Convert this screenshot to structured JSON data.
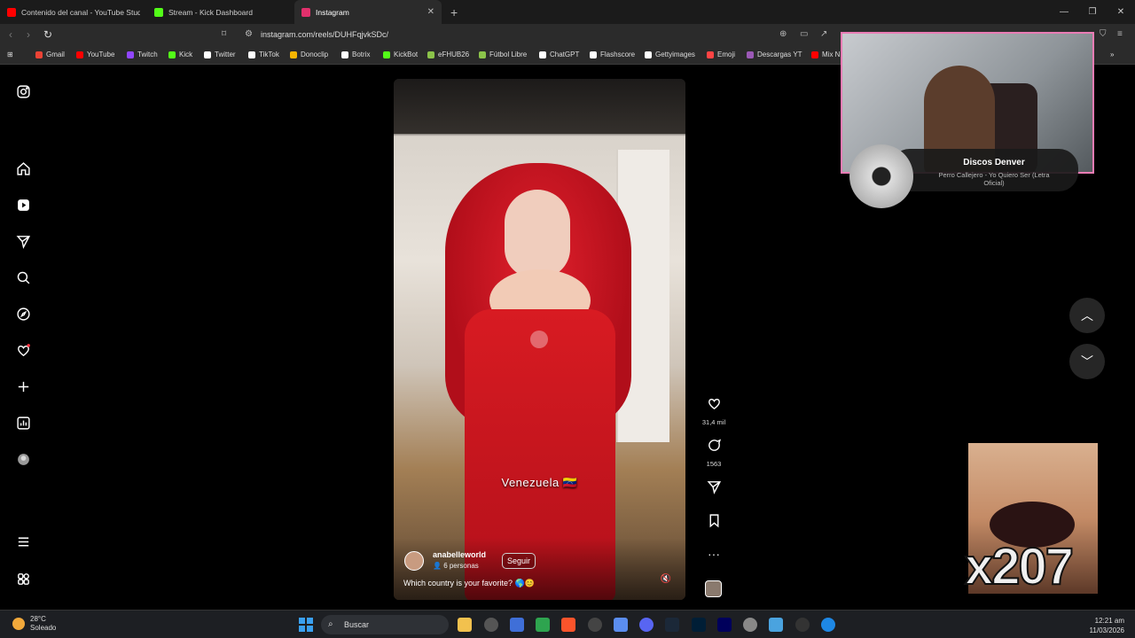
{
  "browser": {
    "tabs": [
      {
        "label": "Contenido del canal - YouTube Studio",
        "color": "#ff0000"
      },
      {
        "label": "Stream - Kick Dashboard",
        "color": "#53fc18"
      },
      {
        "label": "Instagram",
        "color": "#e1306c"
      }
    ],
    "url": "instagram.com/reels/DUHFqjvkSDc/",
    "bookmarks": [
      {
        "label": "Gmail",
        "color": "#ea4335"
      },
      {
        "label": "YouTube",
        "color": "#ff0000"
      },
      {
        "label": "Twitch",
        "color": "#9146ff"
      },
      {
        "label": "Kick",
        "color": "#53fc18"
      },
      {
        "label": "Twitter",
        "color": "#ffffff"
      },
      {
        "label": "TikTok",
        "color": "#ffffff"
      },
      {
        "label": "Donoclip",
        "color": "#f7b500"
      },
      {
        "label": "Botrix",
        "color": "#ffffff"
      },
      {
        "label": "KickBot",
        "color": "#53fc18"
      },
      {
        "label": "eFHUB26",
        "color": "#8bc34a"
      },
      {
        "label": "Fútbol Libre",
        "color": "#8bc34a"
      },
      {
        "label": "ChatGPT",
        "color": "#ffffff"
      },
      {
        "label": "Flashscore",
        "color": "#ffffff"
      },
      {
        "label": "Gettyimages",
        "color": "#ffffff"
      },
      {
        "label": "Emoji",
        "color": "#ff4444"
      },
      {
        "label": "Descargas YT",
        "color": "#9b59b6"
      },
      {
        "label": "Mix N",
        "color": "#ff0000"
      }
    ]
  },
  "reel": {
    "location_text": "Venezuela 🇻🇪",
    "username": "anabelleworld",
    "people": "6 personas",
    "follow_label": "Seguir",
    "caption": "Which country is your favorite? 🌎😊"
  },
  "actions": {
    "likes": "31,4 mil",
    "comments": "1563"
  },
  "music": {
    "artist": "Discos Denver",
    "song": "Perro Callejero - Yo Quiero Ser (Letra Oficial)"
  },
  "meme": {
    "counter": "x207"
  },
  "taskbar": {
    "temperature": "28°C",
    "weather": "Soleado",
    "search_placeholder": "Buscar",
    "time": "12:21 am",
    "date": "11/03/2026"
  }
}
